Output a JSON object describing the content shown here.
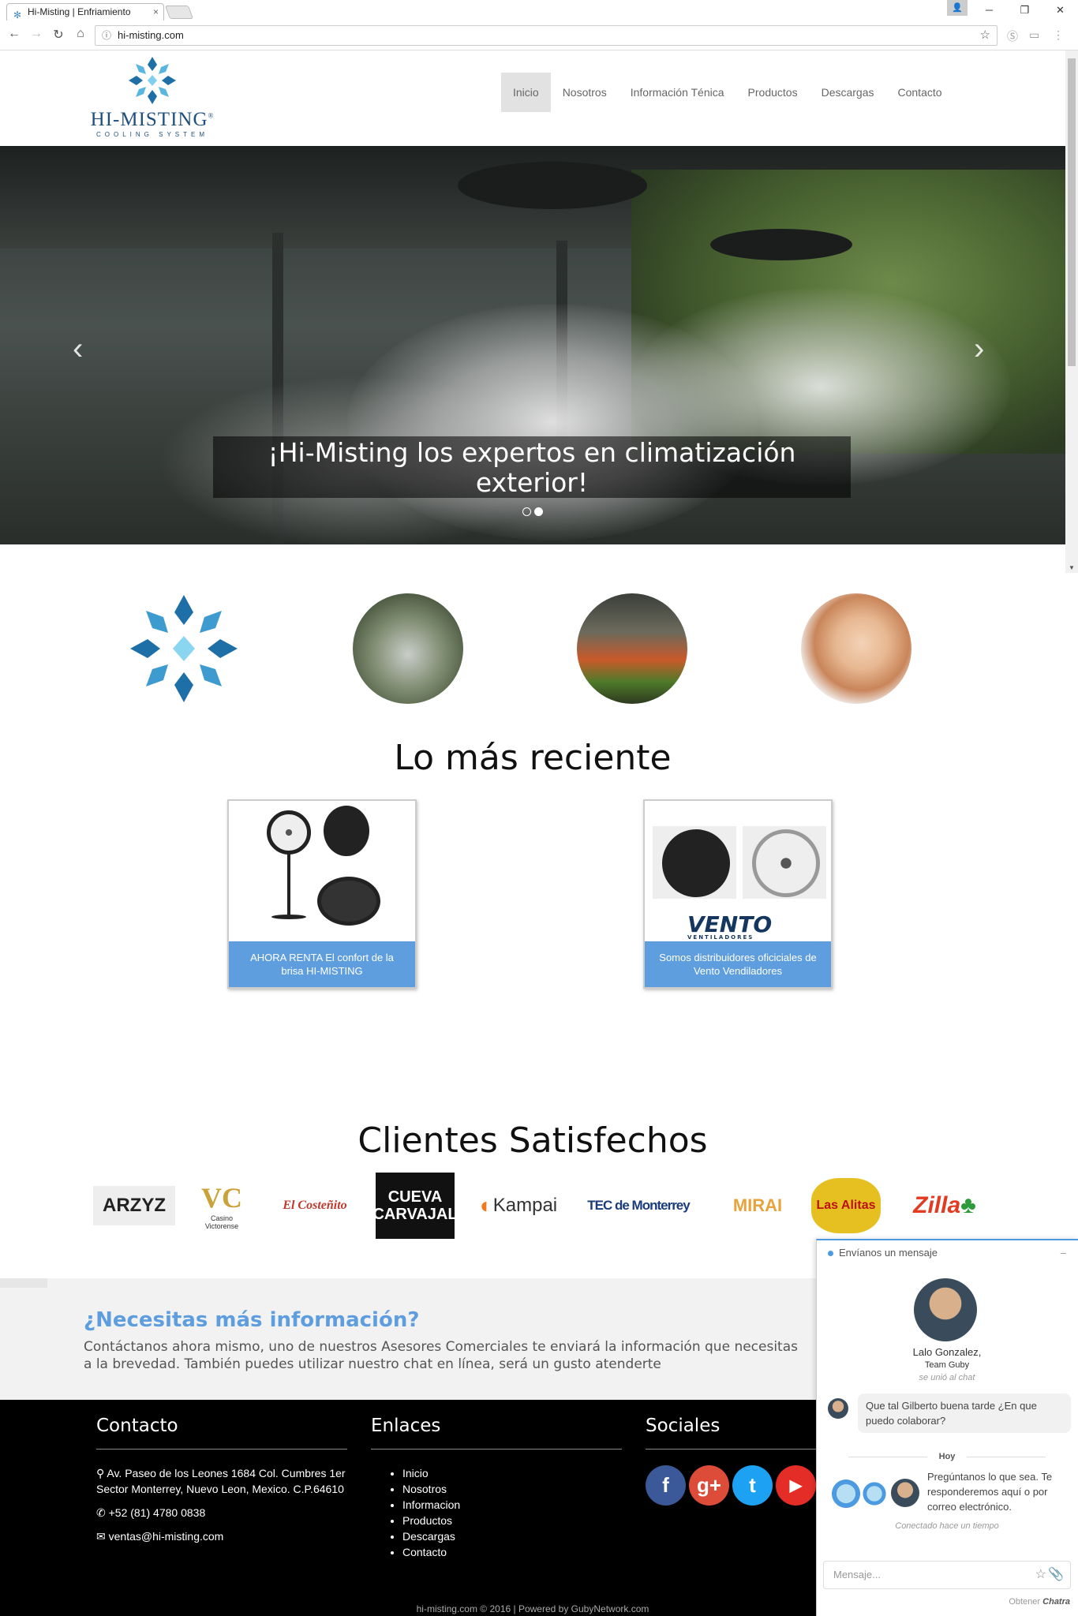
{
  "browser": {
    "tab_title": "Hi-Misting | Enfriamiento",
    "tab_close": "×",
    "url": "hi-misting.com",
    "win_min": "─",
    "win_max": "❐",
    "win_close": "✕"
  },
  "site": {
    "logo": {
      "brand": "HI-MISTING",
      "reg": "®",
      "tagline": "COOLING SYSTEM"
    },
    "nav": [
      "Inicio",
      "Nosotros",
      "Información Ténica",
      "Productos",
      "Descargas",
      "Contacto"
    ],
    "active_nav": "Inicio"
  },
  "hero": {
    "caption": "¡Hi-Misting los expertos en climatización exterior!",
    "slides": 2,
    "active_slide": 2,
    "prev": "‹",
    "next": "›"
  },
  "recent": {
    "title": "Lo más reciente",
    "posts": [
      {
        "caption": "AHORA RENTA El confort de la brisa HI-MISTING"
      },
      {
        "caption": "Somos distribuidores oficiciales de Vento Vendiladores",
        "logo": "VENTO",
        "logo_sub": "VENTILADORES"
      }
    ]
  },
  "clients": {
    "title": "Clientes Satisfechos",
    "logos": [
      {
        "name": "ARZYZ",
        "color": "#222222"
      },
      {
        "name": "Casino Victorense",
        "mark": "VC",
        "color": "#1e2b6f"
      },
      {
        "name": "El Costeñito",
        "color": "#c0392b"
      },
      {
        "name": "CUEVA CARVAJAL",
        "color": "#ffffff"
      },
      {
        "name": "Kampai",
        "color": "#f07b1f"
      },
      {
        "name": "TEC de Monterrey",
        "color": "#1a3c7a"
      },
      {
        "name": "MIRAI",
        "color": "#e8a33d"
      },
      {
        "name": "Las Alitas",
        "color": "#e6c020"
      },
      {
        "name": "Zilla",
        "color": "#e23b21"
      }
    ]
  },
  "info": {
    "title": "¿Necesitas más información?",
    "text": "Contáctanos ahora mismo, uno de nuestros Asesores Comerciales te enviará la información que necesitas a la brevedad. También puedes utilizar nuestro chat en línea, será un gusto atenderte"
  },
  "footer": {
    "contacto": {
      "title": "Contacto",
      "address": "Av. Paseo de los Leones 1684 Col. Cumbres 1er Sector Monterrey, Nuevo Leon, Mexico. C.P.64610",
      "phone": "+52 (81) 4780 0838",
      "email": "ventas@hi-misting.com"
    },
    "enlaces": {
      "title": "Enlaces",
      "items": [
        "Inicio",
        "Nosotros",
        "Informacion",
        "Productos",
        "Descargas",
        "Contacto"
      ]
    },
    "sociales": {
      "title": "Sociales",
      "items": [
        {
          "name": "facebook-icon",
          "glyph": "f",
          "color": "#3b5998"
        },
        {
          "name": "google-plus-icon",
          "glyph": "g+",
          "color": "#dd4b39"
        },
        {
          "name": "twitter-icon",
          "glyph": "t",
          "color": "#1da1f2"
        },
        {
          "name": "youtube-icon",
          "glyph": "▶",
          "color": "#e52d27"
        }
      ]
    },
    "copyright": "hi-misting.com © 2016 | Powered by GubyNetwork.com"
  },
  "chat": {
    "header": "Envíanos un mensaje",
    "minimize": "–",
    "agent_name": "Lalo Gonzalez,",
    "agent_team": "Team Guby",
    "agent_joined": "se unió al chat",
    "message": "Que tal Gilberto buena tarde ¿En que puedo colaborar?",
    "day": "Hoy",
    "intro": "Pregúntanos lo que sea. Te responderemos aquí o por correo electrónico.",
    "connected": "Conectado hace un tiempo",
    "input_placeholder": "Mensaje...",
    "footer_label": "Obtener",
    "footer_brand": "Chatra"
  }
}
